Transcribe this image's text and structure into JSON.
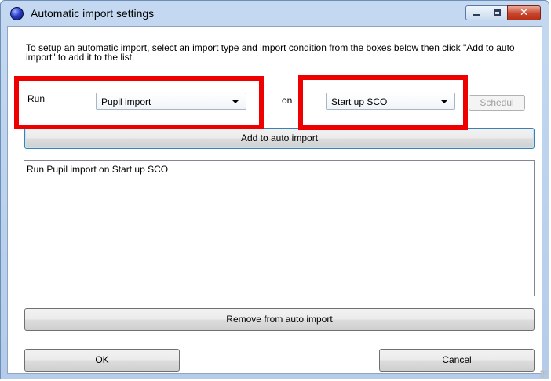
{
  "window": {
    "title": "Automatic import settings",
    "close_glyph": "✕"
  },
  "dialog": {
    "description": "To setup an automatic import, select an import type and import condition from the boxes below then click \"Add to auto import\" to add it to the list.",
    "run_label": "Run",
    "on_label": "on",
    "import_type": {
      "selected": "Pupil import"
    },
    "condition": {
      "selected": "Start up SCO"
    },
    "schedule_button": "Schedul",
    "add_button": "Add to auto import",
    "list_items": [
      "Run Pupil import on Start up SCO"
    ],
    "remove_button": "Remove from auto import",
    "ok_button": "OK",
    "cancel_button": "Cancel"
  },
  "colors": {
    "highlight": "#ee0000",
    "title_bar": "#c4d9f1",
    "close_button": "#c7452d"
  },
  "icons": [
    "app-orb-icon",
    "minimize-icon",
    "maximize-icon",
    "close-icon",
    "dropdown-arrow-icon"
  ]
}
